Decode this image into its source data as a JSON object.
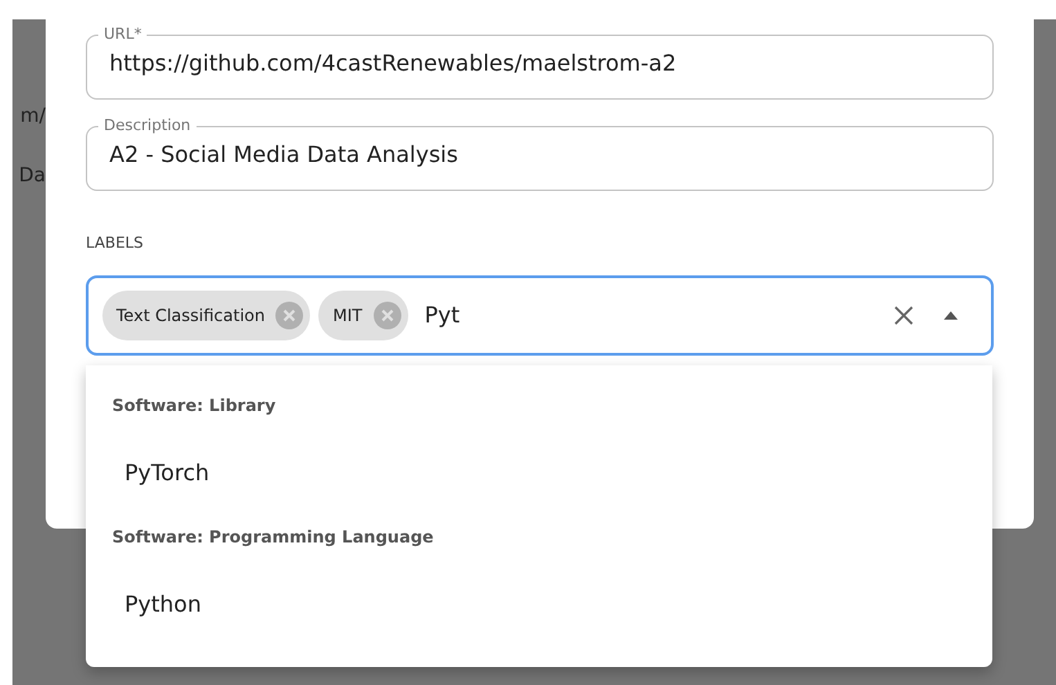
{
  "background": {
    "texts": [
      "m/",
      "Da"
    ]
  },
  "form": {
    "url": {
      "label": "URL*",
      "value": "https://github.com/4castRenewables/maelstrom-a2"
    },
    "description": {
      "label": "Description",
      "value": "A2 - Social Media Data Analysis"
    },
    "labels_heading": "LABELS",
    "labels": {
      "chips": [
        "Text Classification",
        "MIT"
      ],
      "value": "Pyt",
      "expanded": true
    }
  },
  "dropdown": {
    "groups": [
      {
        "heading": "Software: Library",
        "options": [
          {
            "label": "PyTorch",
            "selected": false
          }
        ]
      },
      {
        "heading": "Software: Programming Language",
        "options": [
          {
            "label": "Python",
            "selected": false
          }
        ]
      }
    ]
  }
}
